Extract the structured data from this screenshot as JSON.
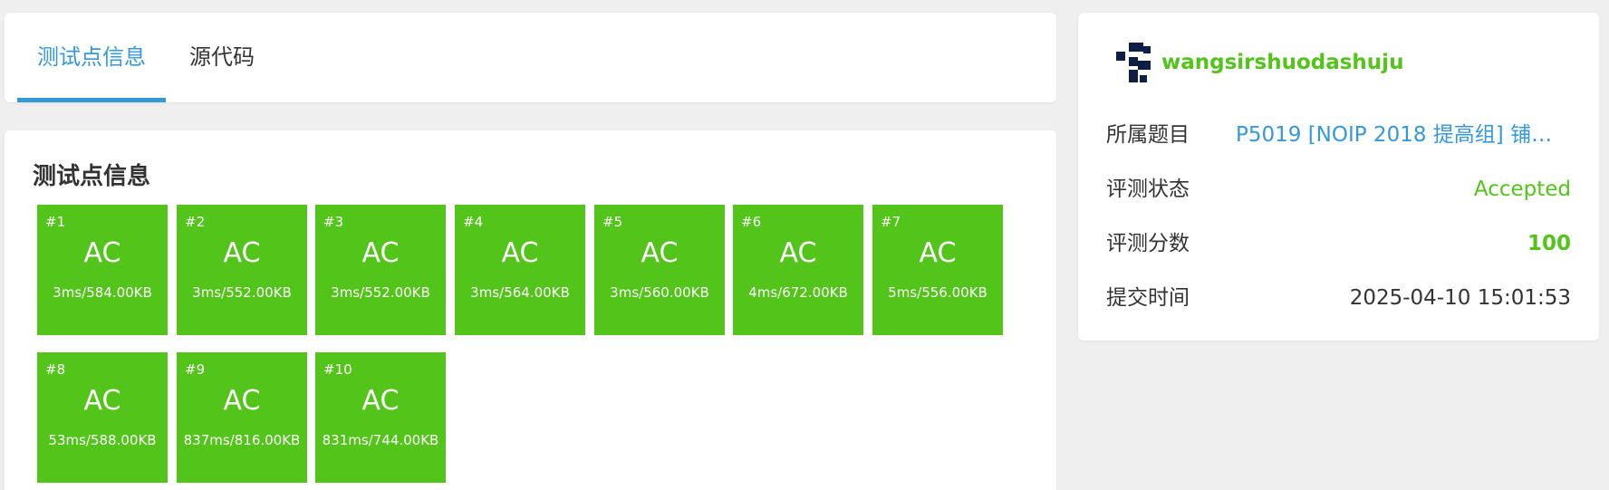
{
  "tabs": [
    {
      "label": "测试点信息",
      "active": true
    },
    {
      "label": "源代码",
      "active": false
    }
  ],
  "cases_title": "测试点信息",
  "cases": [
    {
      "num": "#1",
      "status": "AC",
      "meta": "3ms/584.00KB"
    },
    {
      "num": "#2",
      "status": "AC",
      "meta": "3ms/552.00KB"
    },
    {
      "num": "#3",
      "status": "AC",
      "meta": "3ms/552.00KB"
    },
    {
      "num": "#4",
      "status": "AC",
      "meta": "3ms/564.00KB"
    },
    {
      "num": "#5",
      "status": "AC",
      "meta": "3ms/560.00KB"
    },
    {
      "num": "#6",
      "status": "AC",
      "meta": "4ms/672.00KB"
    },
    {
      "num": "#7",
      "status": "AC",
      "meta": "5ms/556.00KB"
    },
    {
      "num": "#8",
      "status": "AC",
      "meta": "53ms/588.00KB"
    },
    {
      "num": "#9",
      "status": "AC",
      "meta": "837ms/816.00KB"
    },
    {
      "num": "#10",
      "status": "AC",
      "meta": "831ms/744.00KB"
    }
  ],
  "info": {
    "username": "wangsirshuodashuju",
    "problem_label": "所属题目",
    "problem_value": "P5019 [NOIP 2018 提高组] 铺设...",
    "status_label": "评测状态",
    "status_value": "Accepted",
    "score_label": "评测分数",
    "score_value": "100",
    "time_label": "提交时间",
    "time_value": "2025-04-10 15:01:53"
  },
  "colors": {
    "accent": "#3498db",
    "accepted": "#52c41a"
  }
}
